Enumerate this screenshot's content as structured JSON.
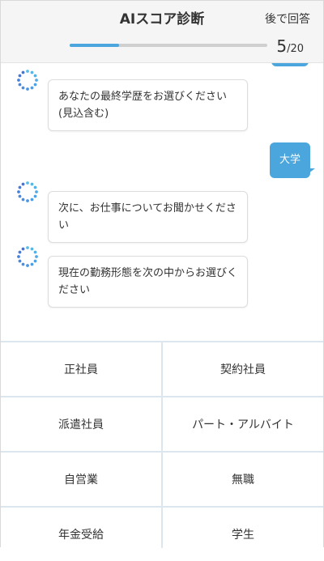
{
  "header": {
    "title": "AIスコア診断",
    "later_label": "後で回答",
    "progress": {
      "current": "5",
      "separator": "/",
      "total": "20",
      "fraction": 0.25
    }
  },
  "messages": [
    {
      "role": "bot",
      "text": "あなたの最終学歴をお選びください (見込含む)"
    },
    {
      "role": "user",
      "text": "大学"
    },
    {
      "role": "bot",
      "text": "次に、お仕事についてお聞かせください"
    },
    {
      "role": "bot",
      "text": "現在の勤務形態を次の中からお選びください"
    }
  ],
  "options": [
    "正社員",
    "契約社員",
    "派遣社員",
    "パート・アルバイト",
    "自営業",
    "無職",
    "年金受給",
    "学生"
  ],
  "colors": {
    "accent": "#4aa6dc",
    "progress_track": "#cfcfcf",
    "grid_line": "#dce6ee"
  },
  "icons": {
    "bot_avatar": "dotted-circle-icon"
  }
}
